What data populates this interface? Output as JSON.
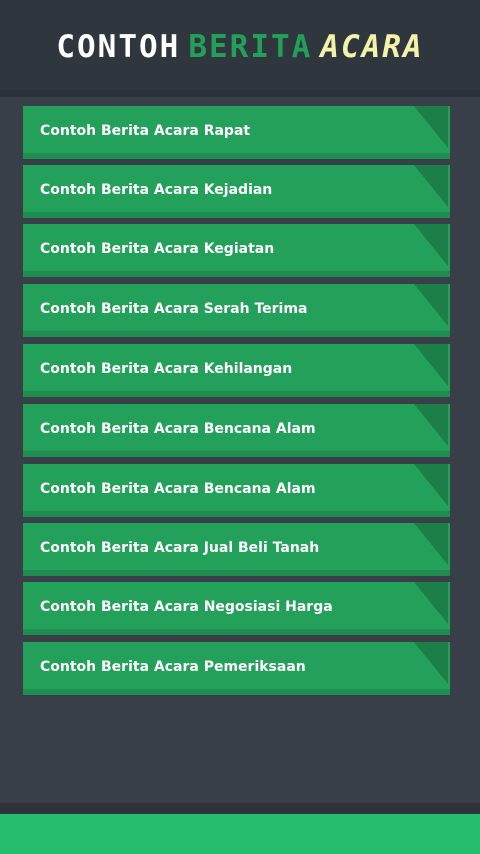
{
  "header": {
    "title_parts": [
      "CONTOH",
      "BERITA",
      "ACARA"
    ]
  },
  "menu": {
    "items": [
      {
        "label": "Contoh Berita Acara Rapat"
      },
      {
        "label": "Contoh Berita Acara Kejadian"
      },
      {
        "label": "Contoh Berita Acara Kegiatan"
      },
      {
        "label": "Contoh Berita Acara Serah Terima"
      },
      {
        "label": "Contoh Berita Acara Kehilangan"
      },
      {
        "label": "Contoh Berita Acara Bencana Alam"
      },
      {
        "label": "Contoh Berita Acara Bencana Alam"
      },
      {
        "label": "Contoh Berita Acara Jual Beli Tanah"
      },
      {
        "label": "Contoh Berita Acara Negosiasi Harga"
      },
      {
        "label": "Contoh Berita Acara Pemeriksaan"
      }
    ]
  },
  "colors": {
    "background": "#383f48",
    "header": "#30363e",
    "item": "#23a15b",
    "item_corner": "#1b7f47",
    "title_white": "#ffffff",
    "title_green": "#22a05a",
    "title_yellow": "#f4f2a8",
    "footer": "#26bd6e"
  }
}
